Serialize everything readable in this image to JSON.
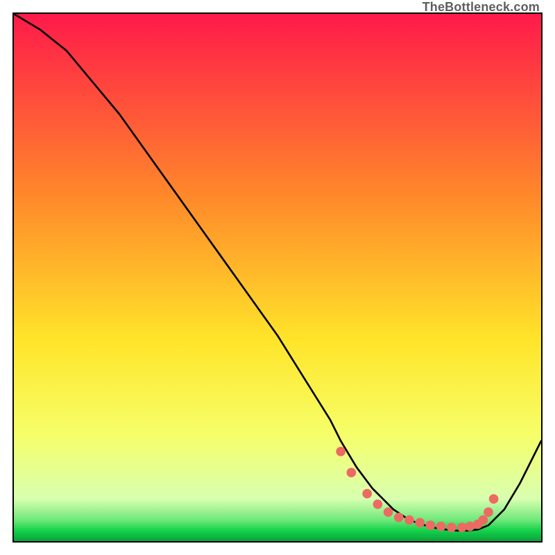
{
  "credit": "TheBottleneck.com",
  "colors": {
    "top": "#ff1a4a",
    "mid_upper": "#ff8a2a",
    "mid": "#ffe52a",
    "mid_lower": "#f6ff6a",
    "green": "#13d24a",
    "dot": "#ec6a62",
    "line": "#000000"
  },
  "chart_data": {
    "type": "line",
    "title": "",
    "xlabel": "",
    "ylabel": "",
    "xlim": [
      0,
      100
    ],
    "ylim": [
      0,
      100
    ],
    "grid": false,
    "legend": false,
    "series": [
      {
        "name": "bottleneck-curve",
        "x": [
          0,
          5,
          10,
          15,
          20,
          25,
          30,
          35,
          40,
          45,
          50,
          55,
          60,
          62,
          65,
          68,
          70,
          72,
          75,
          78,
          80,
          82,
          84,
          86,
          88,
          90,
          93,
          96,
          100
        ],
        "y": [
          100,
          97,
          93,
          87,
          81,
          74,
          67,
          60,
          53,
          46,
          39,
          31,
          23,
          19,
          14,
          10,
          8,
          6,
          4,
          3,
          2.5,
          2.2,
          2,
          2,
          2.2,
          3,
          6,
          11,
          19
        ]
      }
    ],
    "dots": {
      "name": "highlight-dots",
      "x": [
        62,
        64,
        67,
        69,
        71,
        73,
        75,
        77,
        79,
        81,
        83,
        85,
        86.5,
        88,
        89,
        90,
        91
      ],
      "y": [
        17,
        13,
        9,
        7,
        5.5,
        4.5,
        4,
        3.5,
        3,
        2.8,
        2.6,
        2.6,
        2.8,
        3.2,
        4,
        5.5,
        8
      ]
    },
    "gradient_stops": [
      {
        "offset": 0,
        "color": "#ff1a4a"
      },
      {
        "offset": 35,
        "color": "#ff8a2a"
      },
      {
        "offset": 62,
        "color": "#ffe52a"
      },
      {
        "offset": 80,
        "color": "#f6ff6a"
      },
      {
        "offset": 92,
        "color": "#d8ffb0"
      },
      {
        "offset": 96,
        "color": "#6ee87a"
      },
      {
        "offset": 98,
        "color": "#13d24a"
      },
      {
        "offset": 100,
        "color": "#0aa23a"
      }
    ]
  }
}
